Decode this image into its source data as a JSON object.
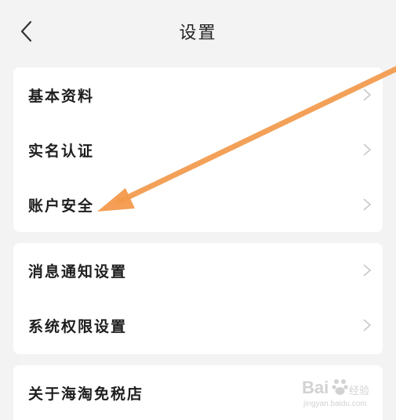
{
  "header": {
    "title": "设置",
    "back_icon": "chevron-left-icon"
  },
  "groups": [
    {
      "items": [
        {
          "label": "基本资料"
        },
        {
          "label": "实名认证"
        },
        {
          "label": "账户安全"
        }
      ]
    },
    {
      "items": [
        {
          "label": "消息通知设置"
        },
        {
          "label": "系统权限设置"
        }
      ]
    },
    {
      "items": [
        {
          "label": "关于海淘免税店"
        }
      ]
    }
  ],
  "annotation": {
    "color": "#f39a4c",
    "points_to": "账户安全"
  },
  "watermark": {
    "brand": "Bai",
    "sub": "经验",
    "url": "jingyan.baidu.com"
  },
  "colors": {
    "background": "#f3f3f3",
    "card": "#ffffff",
    "chevron": "#c8c8c8"
  }
}
